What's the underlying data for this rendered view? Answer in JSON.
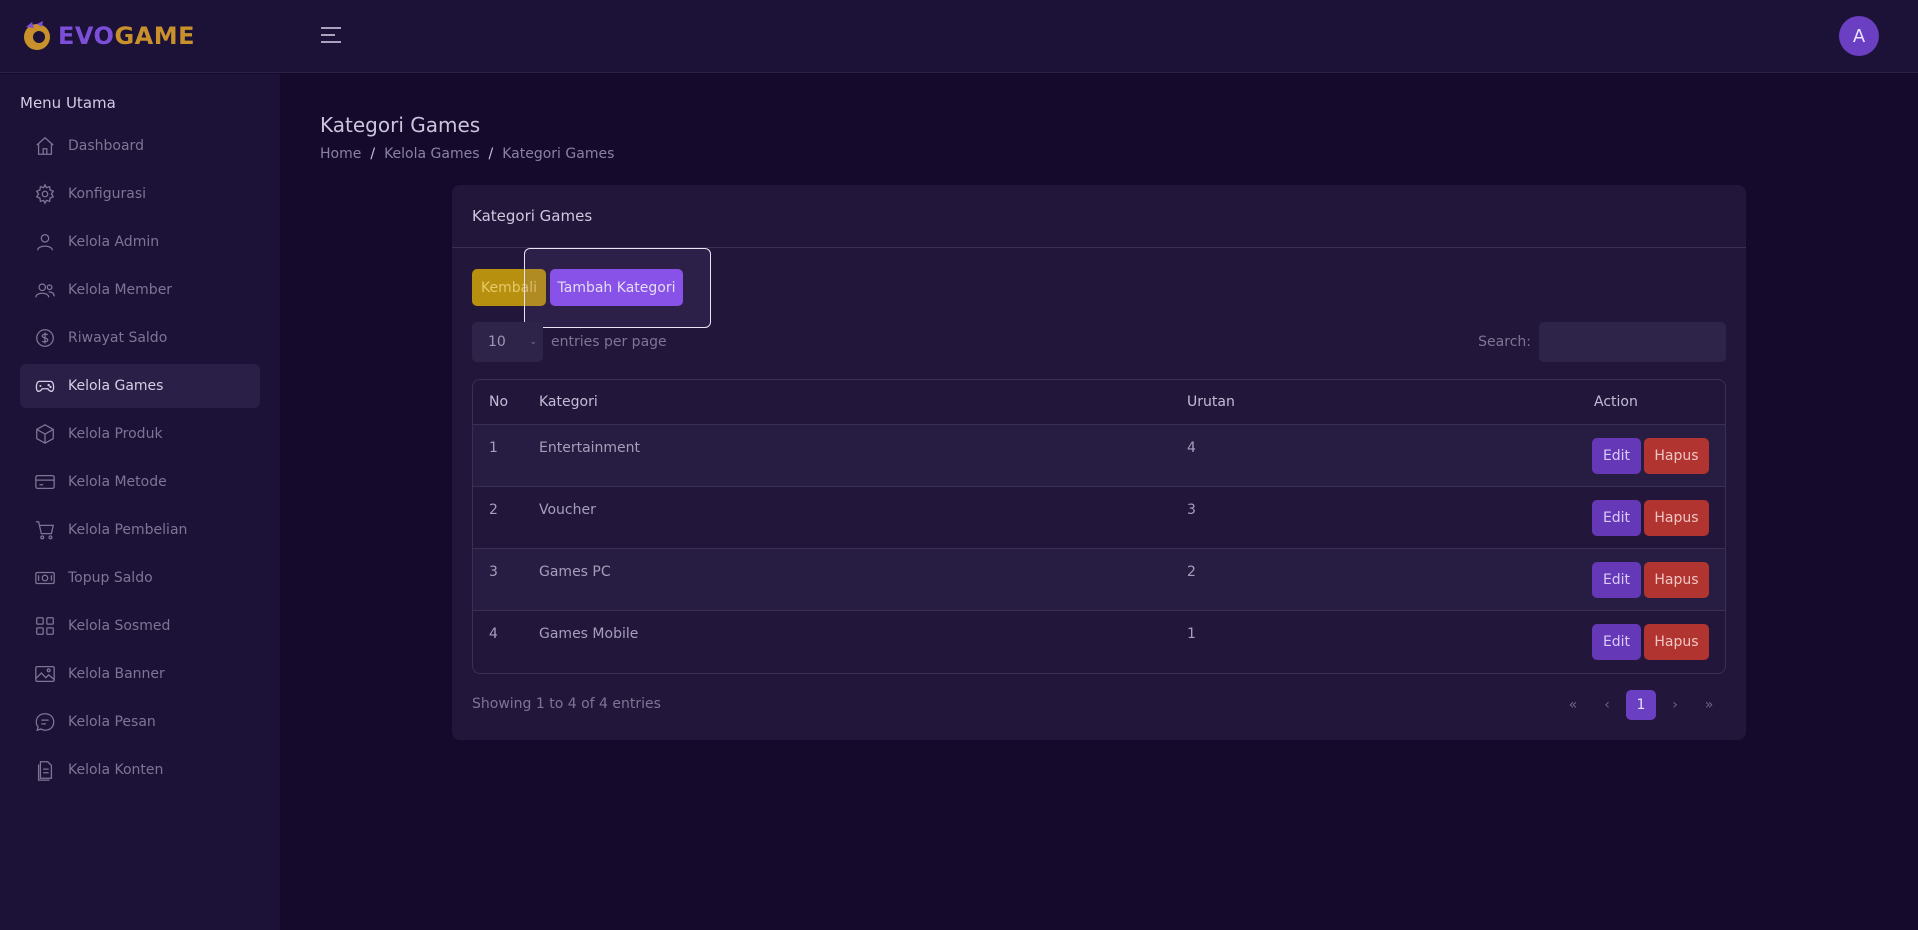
{
  "brand": {
    "evo": "EVO",
    "game": "GAME",
    "accent": "#7b4fd8",
    "accent2": "#c8912b"
  },
  "header": {
    "avatar_letter": "A"
  },
  "sidebar": {
    "heading": "Menu Utama",
    "items": [
      {
        "label": "Dashboard",
        "icon": "home-icon"
      },
      {
        "label": "Konfigurasi",
        "icon": "gear-icon"
      },
      {
        "label": "Kelola Admin",
        "icon": "user-icon"
      },
      {
        "label": "Kelola Member",
        "icon": "users-icon"
      },
      {
        "label": "Riwayat Saldo",
        "icon": "dollar-circle-icon"
      },
      {
        "label": "Kelola Games",
        "icon": "gamepad-icon",
        "active": true
      },
      {
        "label": "Kelola Produk",
        "icon": "box-icon"
      },
      {
        "label": "Kelola Metode",
        "icon": "card-icon"
      },
      {
        "label": "Kelola Pembelian",
        "icon": "cart-icon"
      },
      {
        "label": "Topup Saldo",
        "icon": "money-icon"
      },
      {
        "label": "Kelola Sosmed",
        "icon": "grid-icon"
      },
      {
        "label": "Kelola Banner",
        "icon": "image-icon"
      },
      {
        "label": "Kelola Pesan",
        "icon": "chat-icon"
      },
      {
        "label": "Kelola Konten",
        "icon": "document-icon"
      }
    ]
  },
  "page": {
    "title": "Kategori Games",
    "breadcrumb": [
      "Home",
      "Kelola Games",
      "Kategori Games"
    ]
  },
  "card": {
    "title": "Kategori Games",
    "back_label": "Kembali",
    "add_label": "Tambah Kategori",
    "length_value": "10",
    "length_label": "entries per page",
    "search_label": "Search:",
    "search_value": "",
    "columns": [
      "No",
      "Kategori",
      "Urutan",
      "Action"
    ],
    "rows": [
      {
        "no": "1",
        "kategori": "Entertainment",
        "urutan": "4"
      },
      {
        "no": "2",
        "kategori": "Voucher",
        "urutan": "3"
      },
      {
        "no": "3",
        "kategori": "Games PC",
        "urutan": "2"
      },
      {
        "no": "4",
        "kategori": "Games Mobile",
        "urutan": "1"
      }
    ],
    "edit_label": "Edit",
    "delete_label": "Hapus",
    "info": "Showing 1 to 4 of 4 entries",
    "pager": {
      "first": "«",
      "prev": "‹",
      "current": "1",
      "next": "›",
      "last": "»"
    }
  }
}
